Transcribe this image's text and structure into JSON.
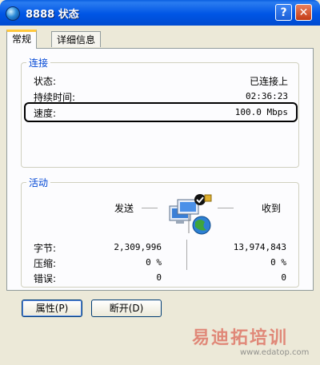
{
  "window": {
    "title": "8888 状态",
    "help_label": "?",
    "close_label": "✕"
  },
  "tabs": [
    {
      "label": "常规"
    },
    {
      "label": "详细信息"
    }
  ],
  "connection": {
    "title": "连接",
    "status_label": "状态:",
    "status_value": "已连接上",
    "duration_label": "持续时间:",
    "duration_value": "02:36:23",
    "speed_label": "速度:",
    "speed_value": "100.0 Mbps"
  },
  "activity": {
    "title": "活动",
    "sent_label": "发送",
    "received_label": "收到",
    "bytes_label": "字节:",
    "bytes_sent": "2,309,996",
    "bytes_received": "13,974,843",
    "compression_label": "压缩:",
    "compression_sent": "0 %",
    "compression_received": "0 %",
    "errors_label": "错误:",
    "errors_sent": "0",
    "errors_received": "0"
  },
  "buttons": {
    "properties": "属性(P)",
    "disconnect": "断开(D)"
  },
  "watermark": {
    "text": "易迪拓培训",
    "url": "www.edatop.com"
  }
}
